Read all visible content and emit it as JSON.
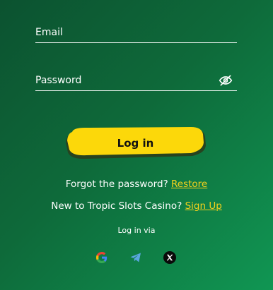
{
  "form": {
    "email_placeholder": "Email",
    "password_placeholder": "Password",
    "login_label": "Log in"
  },
  "forgot": {
    "text": "Forgot the password?",
    "link": "Restore"
  },
  "signup": {
    "text": "New to Tropic Slots Casino?",
    "link": "Sign Up"
  },
  "social": {
    "heading": "Log in via",
    "providers": [
      "google-icon",
      "telegram-icon",
      "x-icon"
    ]
  },
  "colors": {
    "accent": "#f3d11c",
    "button": "#fcd80a",
    "background_dark": "#0c5230",
    "background_light": "#109653"
  }
}
